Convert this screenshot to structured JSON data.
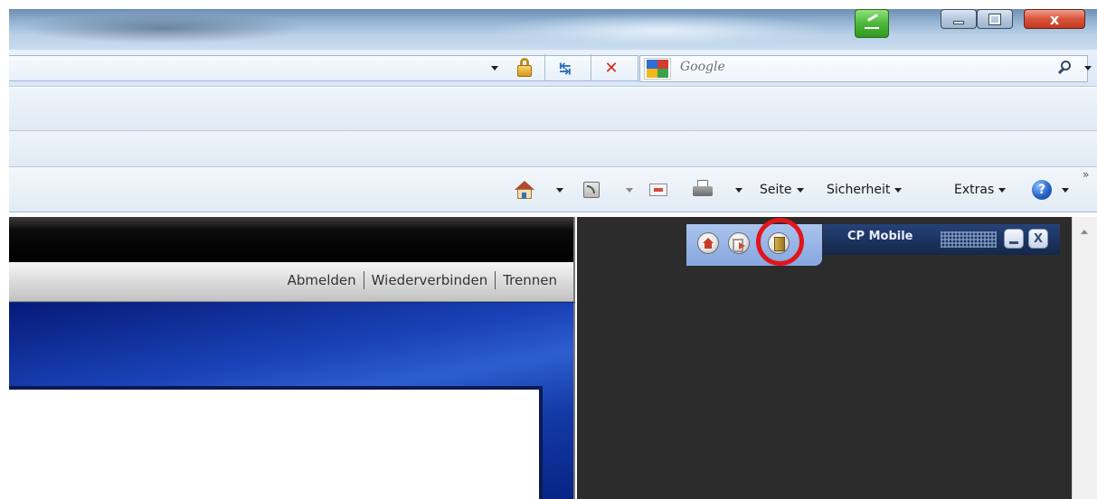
{
  "browser": {
    "search": {
      "placeholder": "Google"
    },
    "command_bar": {
      "seite": "Seite",
      "sicherheit": "Sicherheit",
      "extras": "Extras",
      "help_glyph": "?",
      "overflow_glyph": "»"
    },
    "window_controls": {
      "close_glyph": "x"
    }
  },
  "page": {
    "nav_links": [
      "Abmelden",
      "Wiederverbinden",
      "Trennen"
    ]
  },
  "cp_mobile": {
    "title": "CP Mobile",
    "close_glyph": "X"
  },
  "colors": {
    "highlight_ring": "#e2151a",
    "page_blue": "#1a43b8",
    "dark_panel": "#2c2c2c"
  },
  "icons": [
    "home-icon",
    "feeds-icon",
    "mail-icon",
    "print-icon",
    "help-icon",
    "lock-icon",
    "refresh-icon",
    "stop-icon",
    "search-icon",
    "google-logo-icon",
    "cp-home-icon",
    "cp-exit-icon",
    "cp-door-icon"
  ]
}
